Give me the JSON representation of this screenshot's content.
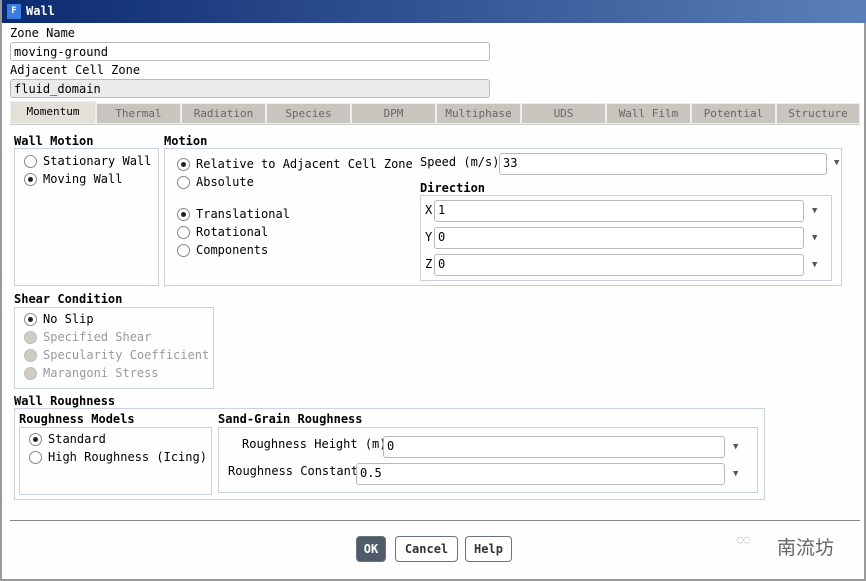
{
  "window": {
    "title": "Wall",
    "icon_letter": "F"
  },
  "zone_name": {
    "label": "Zone Name",
    "value": "moving-ground"
  },
  "adjacent": {
    "label": "Adjacent Cell Zone",
    "value": "fluid_domain"
  },
  "tabs": [
    "Momentum",
    "Thermal",
    "Radiation",
    "Species",
    "DPM",
    "Multiphase",
    "UDS",
    "Wall Film",
    "Potential",
    "Structure"
  ],
  "wall_motion": {
    "label": "Wall Motion",
    "options": [
      "Stationary Wall",
      "Moving Wall"
    ]
  },
  "motion": {
    "label": "Motion",
    "ref_options": [
      "Relative to Adjacent Cell Zone",
      "Absolute"
    ],
    "type_options": [
      "Translational",
      "Rotational",
      "Components"
    ],
    "speed_label": "Speed (m/s)",
    "speed": "33",
    "direction_label": "Direction",
    "x_label": "X",
    "x": "1",
    "y_label": "Y",
    "y": "0",
    "z_label": "Z",
    "z": "0"
  },
  "shear": {
    "label": "Shear Condition",
    "options": [
      "No Slip",
      "Specified Shear",
      "Specularity Coefficient",
      "Marangoni Stress"
    ]
  },
  "roughness": {
    "label": "Wall Roughness",
    "models_label": "Roughness Models",
    "models": [
      "Standard",
      "High Roughness (Icing)"
    ],
    "sand_label": "Sand-Grain Roughness",
    "height_label": "Roughness Height (m)",
    "height": "0",
    "constant_label": "Roughness Constant",
    "constant": "0.5"
  },
  "buttons": {
    "ok": "OK",
    "cancel": "Cancel",
    "help": "Help"
  },
  "watermark": "南流坊"
}
